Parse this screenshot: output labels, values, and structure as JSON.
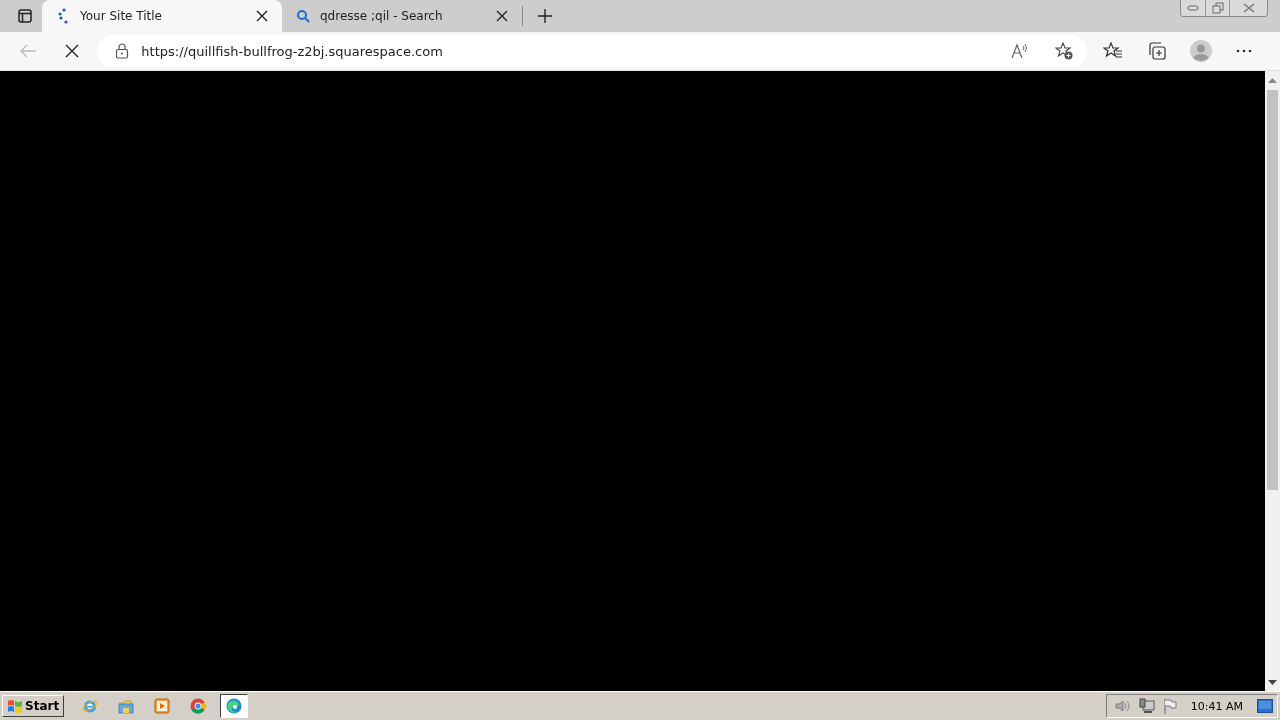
{
  "tabs": [
    {
      "title": "Your Site Title",
      "kind": "site",
      "selected": true
    },
    {
      "title": "qdresse ;qil - Search",
      "kind": "search",
      "selected": false
    }
  ],
  "address_bar": {
    "url": "https://quillfish-bullfrog-z2bj.squarespace.com",
    "loading": true
  },
  "taskbar": {
    "start": "Start",
    "apps": [
      {
        "kind": "ie",
        "selected": false
      },
      {
        "kind": "folder",
        "selected": false
      },
      {
        "kind": "media",
        "selected": false
      },
      {
        "kind": "chrome",
        "selected": false
      },
      {
        "kind": "edge",
        "selected": true
      }
    ],
    "clock": "10:41 AM"
  }
}
